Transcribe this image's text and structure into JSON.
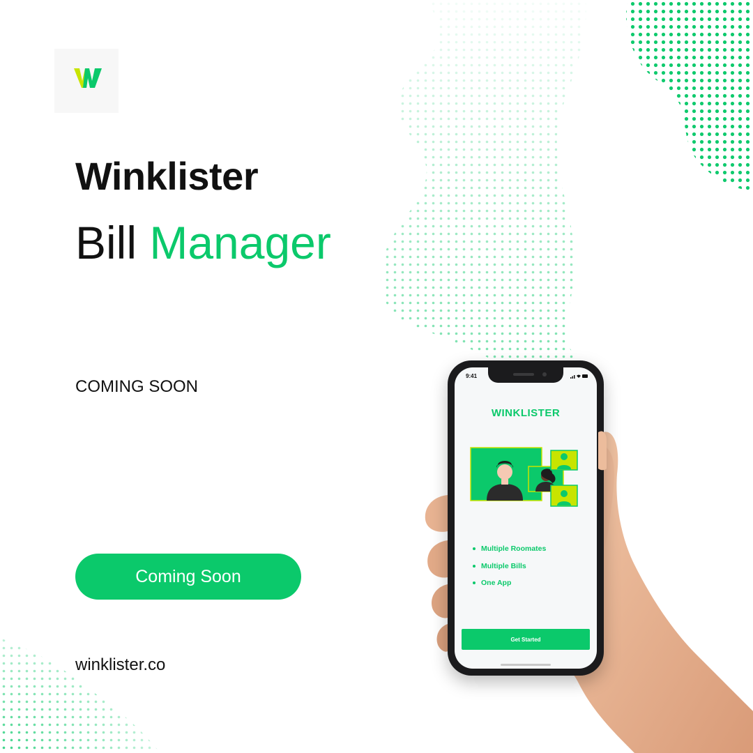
{
  "brand": {
    "name": "Winklister"
  },
  "headline": {
    "word1": "Bill",
    "word2": "Manager"
  },
  "coming_soon_text": "COMING SOON",
  "cta": {
    "label": "Coming Soon"
  },
  "website": "winklister.co",
  "colors": {
    "accent": "#0bc96b",
    "logo_lime": "#c8e400",
    "text": "#111111"
  },
  "phone": {
    "time": "9:41",
    "app_title": "WINKLISTER",
    "features": [
      "Multiple Roomates",
      "Multiple Bills",
      "One App"
    ],
    "button_label": "Get Started"
  }
}
